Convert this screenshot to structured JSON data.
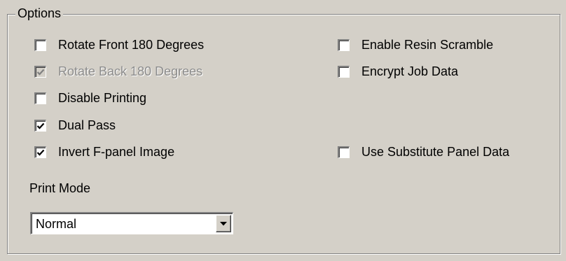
{
  "group": {
    "title": "Options"
  },
  "options": {
    "rotate_front": {
      "label": "Rotate Front 180 Degrees",
      "checked": false,
      "enabled": true
    },
    "rotate_back": {
      "label": "Rotate Back 180 Degrees",
      "checked": true,
      "enabled": false
    },
    "disable_printing": {
      "label": "Disable Printing",
      "checked": false,
      "enabled": true
    },
    "dual_pass": {
      "label": "Dual Pass",
      "checked": true,
      "enabled": true
    },
    "invert_fpanel": {
      "label": "Invert F-panel Image",
      "checked": true,
      "enabled": true
    },
    "resin_scramble": {
      "label": "Enable Resin Scramble",
      "checked": false,
      "enabled": true
    },
    "encrypt_job": {
      "label": "Encrypt Job Data",
      "checked": false,
      "enabled": true
    },
    "substitute_panel": {
      "label": "Use Substitute Panel Data",
      "checked": false,
      "enabled": true
    }
  },
  "print_mode": {
    "label": "Print Mode",
    "value": "Normal"
  }
}
